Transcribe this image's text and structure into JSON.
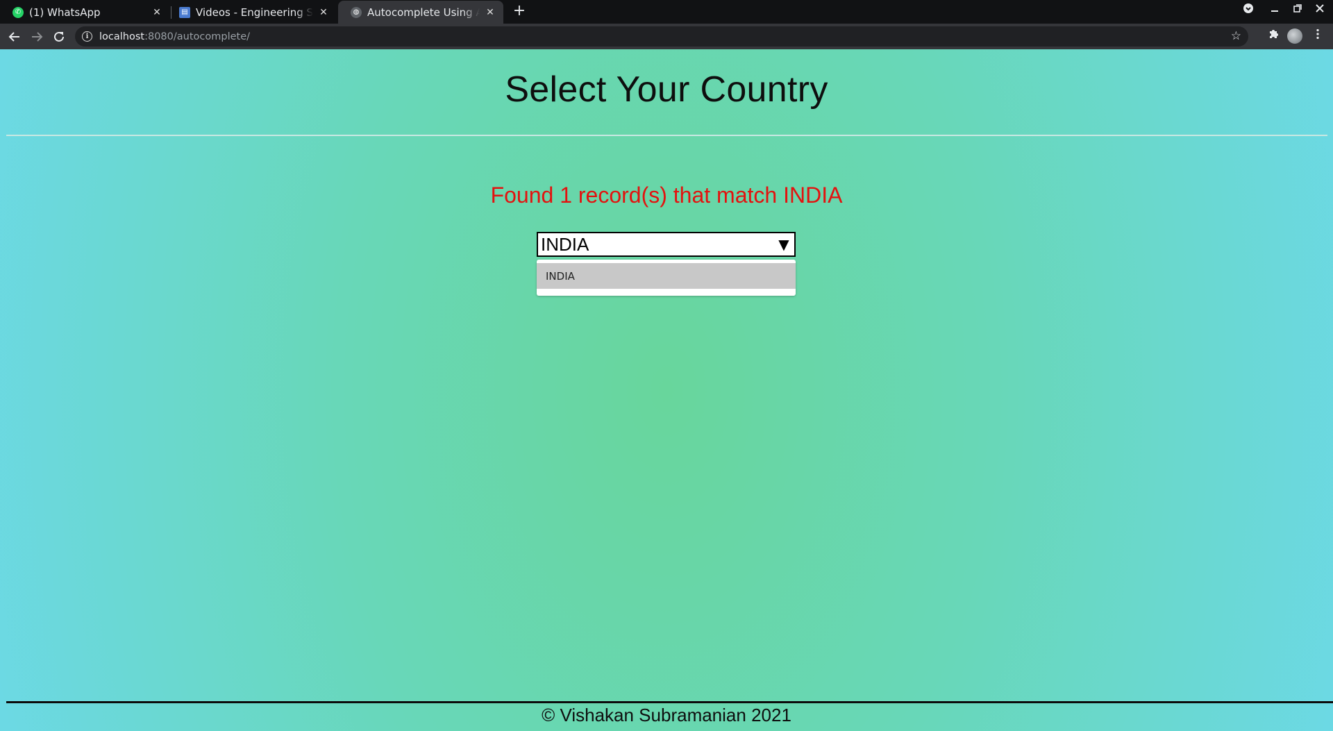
{
  "browser": {
    "tabs": [
      {
        "title": "(1) WhatsApp",
        "icon": "whatsapp-icon",
        "active": false
      },
      {
        "title": "Videos - Engineering Soft",
        "icon": "document-icon",
        "active": false
      },
      {
        "title": "Autocomplete Using AJA",
        "icon": "globe-icon",
        "active": true
      }
    ],
    "new_tab": "+",
    "close_glyph": "✕",
    "url_host": "localhost",
    "url_rest": ":8080/autocomplete/"
  },
  "page": {
    "heading": "Select Your Country",
    "result_message": "Found 1 record(s) that match INDIA",
    "select_value": "INDIA",
    "dropdown_options": [
      "INDIA"
    ],
    "footer": "© Vishakan Subramanian 2021"
  },
  "colors": {
    "result_message": "#e3120f",
    "page_gradient_center": "#68d69c",
    "page_gradient_edge": "#6cd9e8"
  }
}
